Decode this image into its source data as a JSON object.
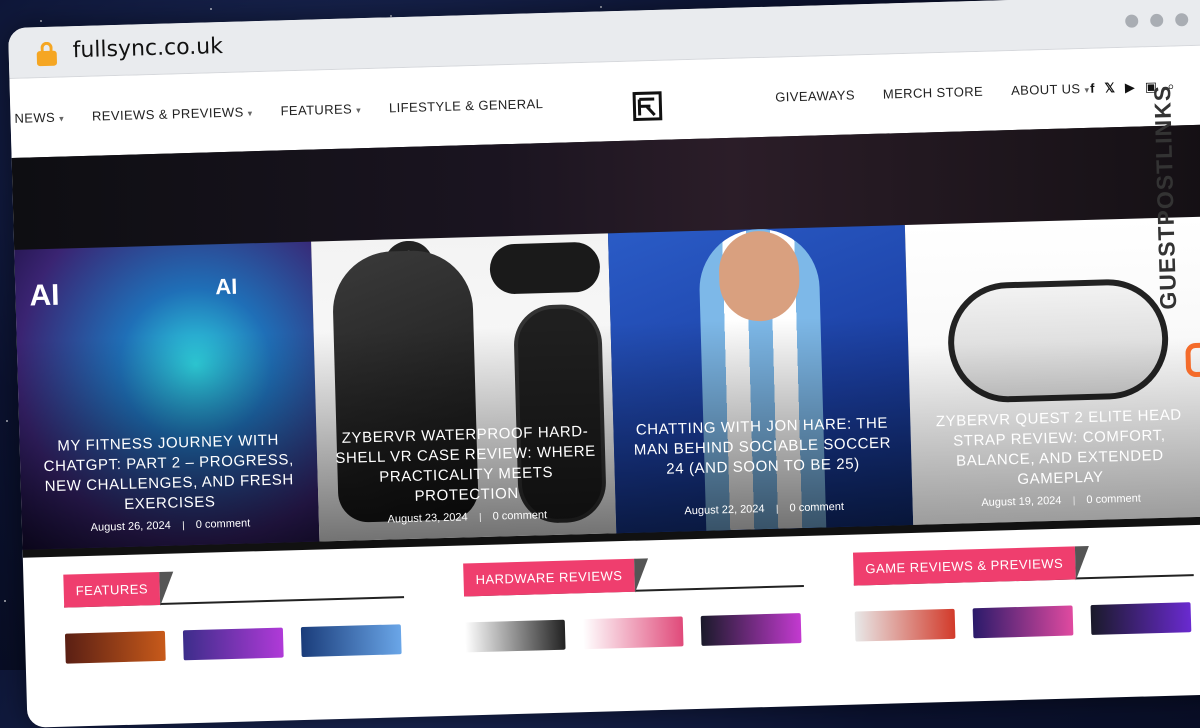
{
  "browser": {
    "url": "fullsync.co.uk"
  },
  "nav": {
    "left": [
      {
        "label": "NEWS",
        "has_dropdown": true
      },
      {
        "label": "REVIEWS & PREVIEWS",
        "has_dropdown": true
      },
      {
        "label": "FEATURES",
        "has_dropdown": true
      },
      {
        "label": "LIFESTYLE & GENERAL",
        "has_dropdown": false
      }
    ],
    "right": [
      {
        "label": "GIVEAWAYS",
        "has_dropdown": false
      },
      {
        "label": "MERCH STORE",
        "has_dropdown": false
      },
      {
        "label": "ABOUT US",
        "has_dropdown": true
      }
    ],
    "socials": [
      "facebook-icon",
      "x-icon",
      "youtube-icon",
      "twitch-icon",
      "search-icon"
    ]
  },
  "hero": {
    "tiles": [
      {
        "title": "MY FITNESS JOURNEY WITH CHATGPT: PART 2 – PROGRESS, NEW CHALLENGES, AND FRESH EXERCISES",
        "date": "August 26, 2024",
        "comments": "0 comment"
      },
      {
        "title": "ZYBERVR WATERPROOF HARD-SHELL VR CASE REVIEW: WHERE PRACTICALITY MEETS PROTECTION",
        "date": "August 23, 2024",
        "comments": "0 comment"
      },
      {
        "title": "CHATTING WITH JON HARE: THE MAN BEHIND SOCIABLE SOCCER 24 (AND SOON TO BE 25)",
        "date": "August 22, 2024",
        "comments": "0 comment"
      },
      {
        "title": "ZYBERVR QUEST 2 ELITE HEAD STRAP REVIEW: COMFORT, BALANCE, AND EXTENDED GAMEPLAY",
        "date": "August 19, 2024",
        "comments": "0 comment"
      }
    ]
  },
  "sections": [
    {
      "label": "FEATURES"
    },
    {
      "label": "HARDWARE REVIEWS"
    },
    {
      "label": "GAME REVIEWS & PREVIEWS"
    }
  ],
  "watermark": {
    "text": "GUESTPOSTLINKS"
  },
  "colors": {
    "accent": "#ef3e6e",
    "lock": "#f5a623"
  }
}
